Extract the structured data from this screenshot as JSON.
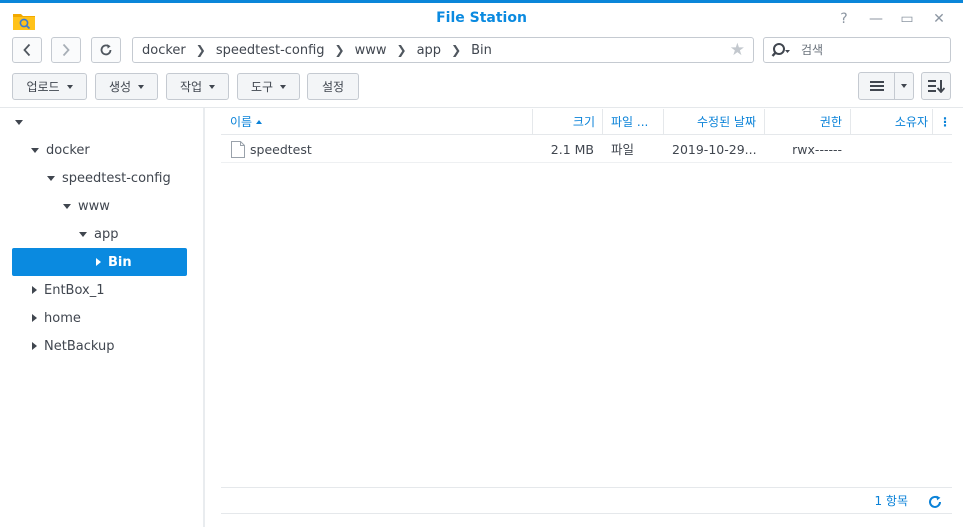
{
  "window": {
    "title": "File Station",
    "help_label": "?",
    "minimize_label": "—",
    "maximize_label": "▭",
    "close_label": "✕"
  },
  "path": [
    "docker",
    "speedtest-config",
    "www",
    "app",
    "Bin"
  ],
  "search": {
    "placeholder": "검색"
  },
  "toolbar": {
    "upload": "업로드",
    "create": "생성",
    "action": "작업",
    "tools": "도구",
    "settings": "설정"
  },
  "tree": {
    "items": [
      {
        "label": "docker"
      },
      {
        "label": "speedtest-config"
      },
      {
        "label": "www"
      },
      {
        "label": "app"
      },
      {
        "label": "Bin"
      },
      {
        "label": "EntBox_1"
      },
      {
        "label": "home"
      },
      {
        "label": "NetBackup"
      }
    ]
  },
  "columns": {
    "name": "이름",
    "size": "크기",
    "type": "파일 ...",
    "modified": "수정된 날짜",
    "permission": "권한",
    "owner": "소유자",
    "more": "⋮"
  },
  "files": [
    {
      "name": "speedtest",
      "size": "2.1 MB",
      "type": "파일",
      "modified": "2019-10-29...",
      "permission": "rwx------",
      "owner": ""
    }
  ],
  "status": {
    "count": "1 항목"
  },
  "colors": {
    "accent": "#0a8ae0",
    "selection": "#0a8ae0",
    "folder": "#f5b400"
  }
}
